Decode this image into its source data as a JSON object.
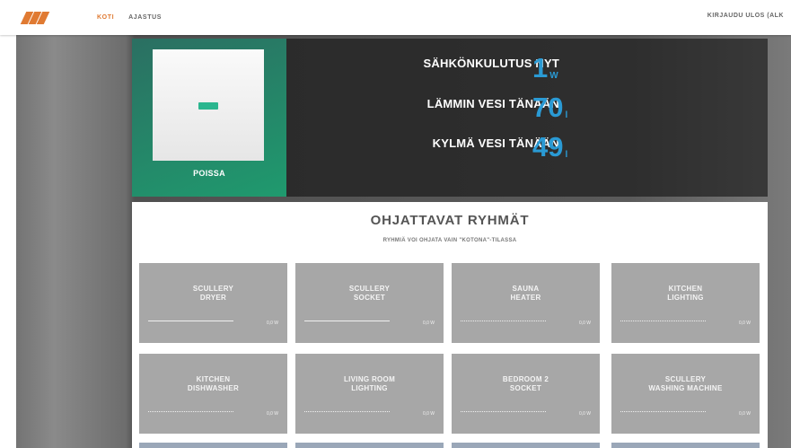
{
  "nav": {
    "logo_text": "",
    "items": [
      "KOTI",
      "AJASTUS"
    ],
    "active": "KOTI",
    "logout": "KIRJAUDU ULOS (ALK"
  },
  "status": {
    "state": "POISSA"
  },
  "stats": {
    "power_label": "SÄHKÖNKULUTUS NYT",
    "power_value": "1",
    "power_unit": "W",
    "hot_label": "LÄMMIN VESI TÄNÄÄN",
    "hot_value": "70",
    "hot_unit": "l",
    "cold_label": "KYLMÄ VESI TÄNÄÄN",
    "cold_value": "49",
    "cold_unit": "l"
  },
  "groups": {
    "title": "OHJATTAVAT RYHMÄT",
    "subtitle": "RYHMIÄ VOI OHJATA VAIN \"KOTONA\"-TILASSA",
    "tiles": [
      {
        "label": "SCULLERY\nDRYER",
        "value": "0,0 W"
      },
      {
        "label": "SCULLERY\nSOCKET",
        "value": "0,0 W"
      },
      {
        "label": "SAUNA\nHEATER",
        "value": "0,0 W"
      },
      {
        "label": "KITCHEN\nLIGHTING",
        "value": "0,0 W"
      },
      {
        "label": "KITCHEN\nDISHWASHER",
        "value": "0,0 W"
      },
      {
        "label": "LIVING ROOM\nLIGHTING",
        "value": "0,0 W"
      },
      {
        "label": "BEDROOM 2\nSOCKET",
        "value": "0,0 W"
      },
      {
        "label": "SCULLERY\nWASHING MACHINE",
        "value": "0,0 W"
      }
    ]
  },
  "colors": {
    "accent": "#e07a32",
    "value_blue": "#2a9ad4",
    "status_green": "#1f9a6e",
    "tile_gray": "#a7a7a7"
  }
}
